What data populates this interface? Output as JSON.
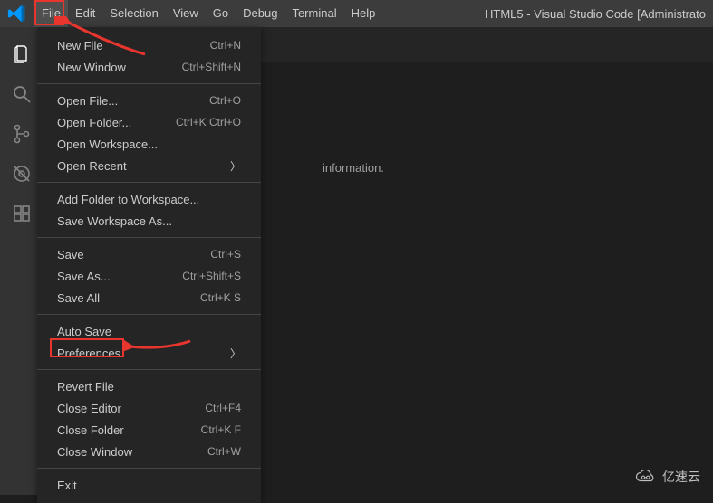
{
  "window_title": "HTML5 - Visual Studio Code [Administrato",
  "menubar": {
    "items": [
      "File",
      "Edit",
      "Selection",
      "View",
      "Go",
      "Debug",
      "Terminal",
      "Help"
    ],
    "active_index": 0
  },
  "dropdown": {
    "groups": [
      [
        {
          "label": "New File",
          "shortcut": "Ctrl+N"
        },
        {
          "label": "New Window",
          "shortcut": "Ctrl+Shift+N"
        }
      ],
      [
        {
          "label": "Open File...",
          "shortcut": "Ctrl+O"
        },
        {
          "label": "Open Folder...",
          "shortcut": "Ctrl+K Ctrl+O"
        },
        {
          "label": "Open Workspace...",
          "shortcut": ""
        },
        {
          "label": "Open Recent",
          "shortcut": "",
          "submenu": true
        }
      ],
      [
        {
          "label": "Add Folder to Workspace...",
          "shortcut": ""
        },
        {
          "label": "Save Workspace As...",
          "shortcut": ""
        }
      ],
      [
        {
          "label": "Save",
          "shortcut": "Ctrl+S"
        },
        {
          "label": "Save As...",
          "shortcut": "Ctrl+Shift+S"
        },
        {
          "label": "Save All",
          "shortcut": "Ctrl+K S"
        }
      ],
      [
        {
          "label": "Auto Save",
          "shortcut": ""
        },
        {
          "label": "Preferences",
          "shortcut": "",
          "submenu": true
        }
      ],
      [
        {
          "label": "Revert File",
          "shortcut": ""
        },
        {
          "label": "Close Editor",
          "shortcut": "Ctrl+F4"
        },
        {
          "label": "Close Folder",
          "shortcut": "Ctrl+K F"
        },
        {
          "label": "Close Window",
          "shortcut": "Ctrl+W"
        }
      ],
      [
        {
          "label": "Exit",
          "shortcut": ""
        }
      ]
    ]
  },
  "panel_text": "information.",
  "watermark_text": "亿速云",
  "colors": {
    "highlight": "#e8352e",
    "bg": "#1e1e1e",
    "menu_bg": "#252526",
    "menubar_bg": "#3c3c3c"
  }
}
